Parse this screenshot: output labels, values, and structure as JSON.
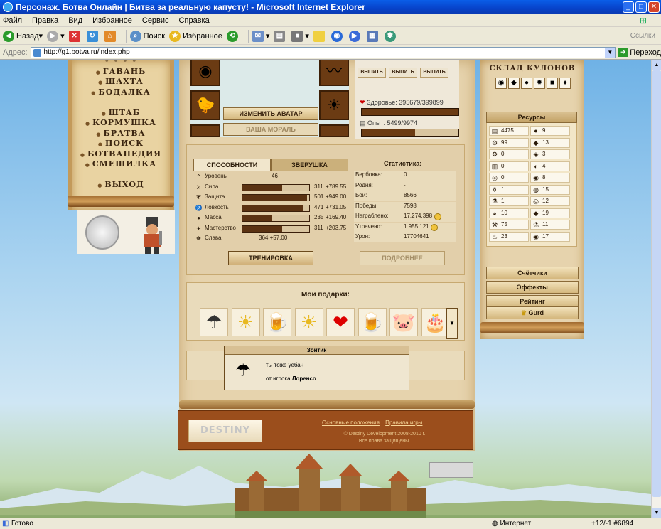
{
  "window": {
    "title": "Персонаж. Ботва Онлайн | Битва за реальную капусту! - Microsoft Internet Explorer"
  },
  "menu": [
    "Файл",
    "Правка",
    "Вид",
    "Избранное",
    "Сервис",
    "Справка"
  ],
  "toolbar": {
    "back": "Назад",
    "search": "Поиск",
    "favorites": "Избранное",
    "links": "Ссылки"
  },
  "address": {
    "label": "Адрес:",
    "url": "http://g1.botva.ru/index.php",
    "go": "Переход"
  },
  "status": {
    "left": "Готово",
    "zone": "Интернет",
    "right": "+12/-1  #6894"
  },
  "nav": [
    "ГАВАНЬ",
    "ШАХТА",
    "БОДАЛКА",
    "ШТАБ",
    "КОРМУШКА",
    "БРАТВА",
    "ПОИСК",
    "БОТВАПЕДИЯ",
    "СМЕШИЛКА",
    "ВЫХОД"
  ],
  "avatar": {
    "change": "ИЗМЕНИТЬ АВАТАР",
    "morale": "ВАША МОРАЛЬ"
  },
  "drinks": [
    "ВЫПИТЬ",
    "ВЫПИТЬ",
    "ВЫПИТЬ"
  ],
  "vitals": {
    "health_label": "Здоровье: 395679/399899",
    "health_fraction": 0.99,
    "exp_label": "Опыт: 5499/9974",
    "exp_fraction": 0.55
  },
  "tabs": {
    "abilities": "СПОСОБНОСТИ",
    "pet": "ЗВЕРУШКА",
    "stats_title": "Статистика:"
  },
  "abilities": [
    {
      "name": "Уровень",
      "value": "46",
      "bonus": "",
      "fraction": null,
      "icon": "chevron-icon"
    },
    {
      "name": "Сила",
      "value": "311",
      "bonus": "+789.55",
      "fraction": 0.6,
      "icon": "sword-icon"
    },
    {
      "name": "Защита",
      "value": "501",
      "bonus": "+949.00",
      "fraction": 0.97,
      "icon": "shield-icon"
    },
    {
      "name": "Ловкость",
      "value": "471",
      "bonus": "+731.05",
      "fraction": 0.9,
      "icon": "runner-icon"
    },
    {
      "name": "Масса",
      "value": "235",
      "bonus": "+169.40",
      "fraction": 0.45,
      "icon": "weight-icon"
    },
    {
      "name": "Мастерство",
      "value": "311",
      "bonus": "+203.75",
      "fraction": 0.6,
      "icon": "craft-icon"
    },
    {
      "name": "Слава",
      "value": "364 +57.00",
      "bonus": "",
      "fraction": null,
      "icon": "fame-icon"
    }
  ],
  "stats": [
    {
      "k": "Вербовка:",
      "v": "0"
    },
    {
      "k": "Родня:",
      "v": "-"
    },
    {
      "k": "Бои:",
      "v": "8566"
    },
    {
      "k": "Победы:",
      "v": "7598"
    },
    {
      "k": "Награблено:",
      "v": "17.274.398"
    },
    {
      "k": "Утрачено:",
      "v": "1.955.121"
    },
    {
      "k": "Урон:",
      "v": "17704641"
    }
  ],
  "buttons": {
    "train": "ТРЕНИРОВКА",
    "more": "ПОДРОБНЕЕ"
  },
  "gifts": {
    "title": "Мои подарки:",
    "items": [
      "umbrella-icon",
      "bear-sun-icon",
      "mug-icon",
      "bear-sun-icon",
      "heart-icon",
      "mug-icon",
      "pig-icon",
      "cake-icon"
    ]
  },
  "tooltip": {
    "title": "Зонтик",
    "text": "ты тоже уебан",
    "from_prefix": "от игрока",
    "from_player": "Лоренсо"
  },
  "footer": {
    "logo": "DESTINY",
    "links": [
      "Основные положения",
      "Правила игры"
    ],
    "copy1": "© Destiny Development 2008-2010 г.",
    "copy2": "Все права защищены."
  },
  "right": {
    "title": "СКЛАД КУЛОНОВ",
    "resources_title": "Ресурсы",
    "resources": [
      [
        "4475",
        "9"
      ],
      [
        "99",
        "13"
      ],
      [
        "0",
        "3"
      ],
      [
        "0",
        "4"
      ],
      [
        "0",
        "8"
      ],
      [
        "1",
        "15"
      ],
      [
        "1",
        "12"
      ],
      [
        "10",
        "19"
      ],
      [
        "75",
        "11"
      ],
      [
        "23",
        "17"
      ]
    ],
    "buttons": [
      "Счётчики",
      "Эффекты",
      "Рейтинг"
    ],
    "clan": "Gurd"
  }
}
